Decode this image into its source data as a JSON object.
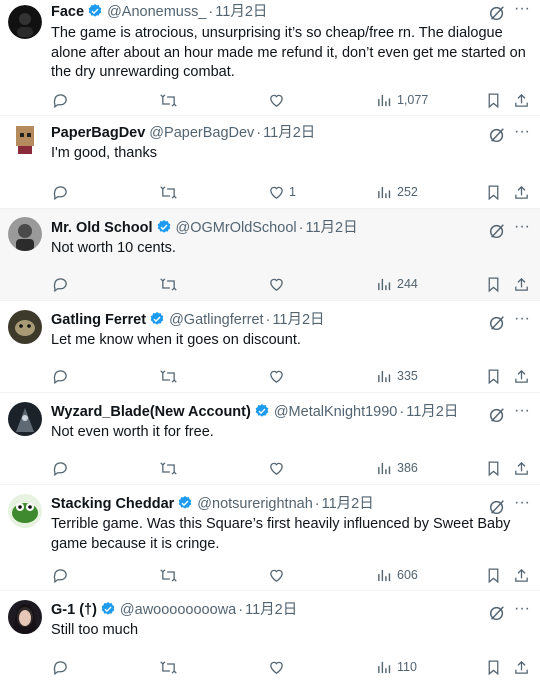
{
  "tweets": [
    {
      "name": "Face",
      "handle": "@Anonemuss_",
      "dot": "·",
      "date": "11月2日",
      "text": "The game is atrocious, unsurprising it’s so cheap/free rn. The dialogue alone after about an hour made me refund it, don’t even get me started on the dry unrewarding combat.",
      "likes": "",
      "views": "1,077",
      "avatar_color": "#111111"
    },
    {
      "name": "PaperBagDev",
      "handle": "@PaperBagDev",
      "dot": "·",
      "date": "11月2日",
      "text": "I'm good, thanks",
      "likes": "1",
      "views": "252",
      "avatar_color": "#b58a5c"
    },
    {
      "name": "Mr. Old School",
      "handle": "@OGMrOldSchool",
      "dot": "·",
      "date": "11月2日",
      "text": "Not worth 10 cents.",
      "likes": "",
      "views": "244",
      "avatar_color": "#6b6b6b"
    },
    {
      "name": "Gatling Ferret",
      "handle": "@Gatlingferret",
      "dot": "·",
      "date": "11月2日",
      "text": "Let me know when it goes on discount.",
      "likes": "",
      "views": "335",
      "avatar_color": "#5a5240"
    },
    {
      "name": "Wyzard_Blade(New Account)",
      "handle": "@MetalKnight1990",
      "dot": "·",
      "date": "11月2日",
      "text": "Not even worth it for free.",
      "likes": "",
      "views": "386",
      "avatar_color": "#2a2f36"
    },
    {
      "name": "Stacking Cheddar",
      "handle": "@notsurerightnah",
      "dot": "·",
      "date": "11月2日",
      "text": "Terrible game.  Was this Square’s first heavily influenced by Sweet Baby game because it is cringe.",
      "likes": "",
      "views": "606",
      "avatar_color": "#3f8a2e"
    },
    {
      "name": "G-1 (†)",
      "handle": "@awoooooooowa",
      "dot": "·",
      "date": "11月2日",
      "text": "Still too much",
      "likes": "",
      "views": "110",
      "avatar_color": "#1e1a22"
    }
  ],
  "colors": {
    "text": "#0f1419",
    "muted": "#536471",
    "verified": "#1d9bf0",
    "highlight_bg": "#f7f7f7",
    "divider": "#eff3f4"
  },
  "icons": [
    "verified-badge-icon",
    "grok-icon",
    "more-icon",
    "reply-icon",
    "retweet-icon",
    "like-icon",
    "views-icon",
    "bookmark-icon",
    "share-icon"
  ]
}
